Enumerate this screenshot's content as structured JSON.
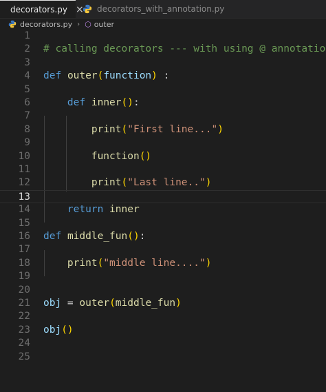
{
  "tabs": [
    {
      "label": "decorators.py",
      "close": "×",
      "icon": "python-icon"
    },
    {
      "label": "decorators_with_annotation.py",
      "icon": "python-icon"
    }
  ],
  "breadcrumb": {
    "file": "decorators.py",
    "separator": "›",
    "symbol": "outer",
    "symbol_icon": "cube-icon"
  },
  "colors": {
    "keyword": "#569cd6",
    "function": "#dcdcaa",
    "variable": "#9cdcfe",
    "string": "#ce9178",
    "comment": "#6a9955",
    "bracket1": "#ffd700",
    "bracket2": "#da70d6"
  },
  "editor": {
    "current_line": 13,
    "lines": [
      {
        "n": "1",
        "tokens": []
      },
      {
        "n": "2",
        "tokens": [
          [
            "cm",
            "# calling decorators --- with using @ annotation"
          ]
        ]
      },
      {
        "n": "3",
        "tokens": []
      },
      {
        "n": "4",
        "tokens": [
          [
            "kw",
            "def"
          ],
          [
            "",
            " "
          ],
          [
            "fn",
            "outer"
          ],
          [
            "p1",
            "("
          ],
          [
            "var",
            "function"
          ],
          [
            "p1",
            ")"
          ],
          [
            "",
            " :"
          ]
        ]
      },
      {
        "n": "5",
        "tokens": []
      },
      {
        "n": "6",
        "tokens": [
          [
            "",
            "    "
          ],
          [
            "kw",
            "def"
          ],
          [
            "",
            " "
          ],
          [
            "fn",
            "inner"
          ],
          [
            "p1",
            "()"
          ],
          [
            "",
            ":"
          ]
        ]
      },
      {
        "n": "7",
        "tokens": []
      },
      {
        "n": "8",
        "tokens": [
          [
            "",
            "        "
          ],
          [
            "fn",
            "print"
          ],
          [
            "p1",
            "("
          ],
          [
            "str",
            "\"First line...\""
          ],
          [
            "p1",
            ")"
          ]
        ]
      },
      {
        "n": "9",
        "tokens": []
      },
      {
        "n": "10",
        "tokens": [
          [
            "",
            "        "
          ],
          [
            "fn",
            "function"
          ],
          [
            "p1",
            "()"
          ]
        ]
      },
      {
        "n": "11",
        "tokens": []
      },
      {
        "n": "12",
        "tokens": [
          [
            "",
            "        "
          ],
          [
            "fn",
            "print"
          ],
          [
            "p1",
            "("
          ],
          [
            "str",
            "\"Last line..\""
          ],
          [
            "p1",
            ")"
          ]
        ]
      },
      {
        "n": "13",
        "tokens": []
      },
      {
        "n": "14",
        "tokens": [
          [
            "",
            "    "
          ],
          [
            "kw",
            "return"
          ],
          [
            "",
            " "
          ],
          [
            "fn",
            "inner"
          ]
        ]
      },
      {
        "n": "15",
        "tokens": []
      },
      {
        "n": "16",
        "tokens": [
          [
            "kw",
            "def"
          ],
          [
            "",
            " "
          ],
          [
            "fn",
            "middle_fun"
          ],
          [
            "p1",
            "()"
          ],
          [
            "",
            ":"
          ]
        ]
      },
      {
        "n": "17",
        "tokens": []
      },
      {
        "n": "18",
        "tokens": [
          [
            "",
            "    "
          ],
          [
            "fn",
            "print"
          ],
          [
            "p1",
            "("
          ],
          [
            "str",
            "\"middle line....\""
          ],
          [
            "p1",
            ")"
          ]
        ]
      },
      {
        "n": "19",
        "tokens": []
      },
      {
        "n": "20",
        "tokens": []
      },
      {
        "n": "21",
        "tokens": [
          [
            "var",
            "obj"
          ],
          [
            "",
            " = "
          ],
          [
            "fn",
            "outer"
          ],
          [
            "p1",
            "("
          ],
          [
            "fn",
            "middle_fun"
          ],
          [
            "p1",
            ")"
          ]
        ]
      },
      {
        "n": "22",
        "tokens": []
      },
      {
        "n": "23",
        "tokens": [
          [
            "var",
            "obj"
          ],
          [
            "p1",
            "()"
          ]
        ]
      },
      {
        "n": "24",
        "tokens": []
      },
      {
        "n": "25",
        "tokens": []
      }
    ]
  }
}
